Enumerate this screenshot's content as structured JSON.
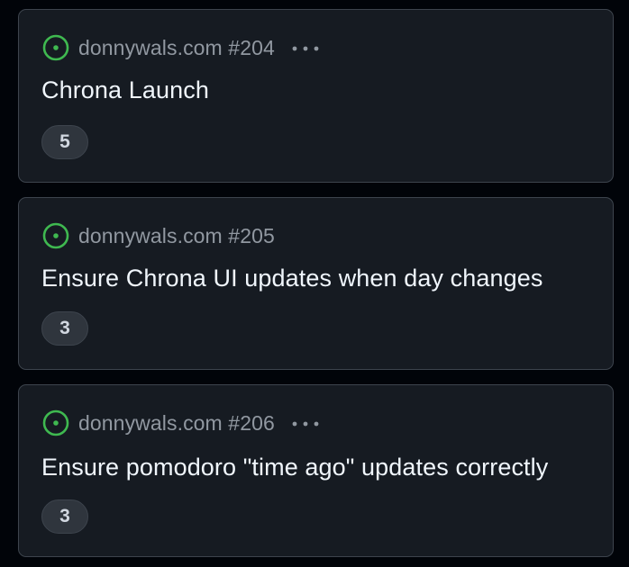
{
  "cards": [
    {
      "repo_ref": "donnywals.com #204",
      "title": "Chrona Launch",
      "count": "5",
      "status_icon": "issue-open-icon",
      "has_menu": true
    },
    {
      "repo_ref": "donnywals.com #205",
      "title": "Ensure Chrona UI updates when day changes",
      "count": "3",
      "status_icon": "issue-open-icon",
      "has_menu": false
    },
    {
      "repo_ref": "donnywals.com #206",
      "title": "Ensure pomodoro \"time ago\" updates correctly",
      "count": "3",
      "status_icon": "issue-open-icon",
      "has_menu": true
    }
  ],
  "colors": {
    "background": "#010409",
    "card": "#161b22",
    "border": "#3d444d",
    "open_status": "#3fb950",
    "muted_text": "#9198a1",
    "title_text": "#f0f6fc"
  },
  "icons": {
    "menu": "kebab-horizontal-icon"
  }
}
